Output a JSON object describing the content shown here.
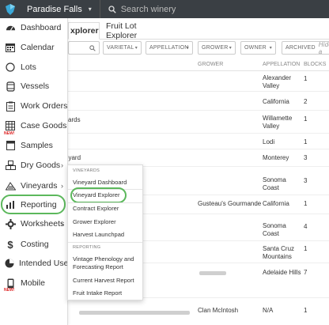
{
  "header": {
    "winery": "Paradise Falls",
    "search_placeholder": "Search winery"
  },
  "sidebar": {
    "items": [
      {
        "label": "Dashboard",
        "icon": "dashboard-icon"
      },
      {
        "label": "Calendar",
        "icon": "calendar-icon"
      },
      {
        "label": "Lots",
        "icon": "lots-icon"
      },
      {
        "label": "Vessels",
        "icon": "vessels-icon"
      },
      {
        "label": "Work Orders",
        "icon": "work-orders-icon"
      },
      {
        "label": "Case Goods",
        "icon": "case-goods-icon",
        "badge": "NEW!"
      },
      {
        "label": "Samples",
        "icon": "samples-icon"
      },
      {
        "label": "Dry Goods",
        "icon": "dry-goods-icon"
      },
      {
        "label": "Vineyards",
        "icon": "vineyards-icon"
      },
      {
        "label": "Reporting",
        "icon": "reporting-icon"
      },
      {
        "label": "Worksheets",
        "icon": "worksheets-icon"
      },
      {
        "label": "Costing",
        "icon": "costing-icon"
      },
      {
        "label": "Intended Use",
        "icon": "intended-use-icon"
      },
      {
        "label": "Mobile",
        "icon": "mobile-icon",
        "badge": "NEW!"
      }
    ]
  },
  "tabs": {
    "active": "xplorer",
    "other": "Fruit Lot Explorer"
  },
  "filters": {
    "varietal": "VARIETAL",
    "appellation": "APPELLATION",
    "grower": "GROWER",
    "owner": "OWNER",
    "archived": "ARCHIVED",
    "hide": "Hide a"
  },
  "table": {
    "headers": {
      "grower": "GROWER",
      "appellation": "APPELLATION",
      "blocks": "BLOCKS"
    },
    "rows": [
      {
        "name": "",
        "grower": "",
        "appellation": "Alexander Valley",
        "blocks": "1"
      },
      {
        "name": "o",
        "grower": "",
        "appellation": "California",
        "blocks": "2"
      },
      {
        "name": "ards",
        "grower": "",
        "appellation": "Willamette Valley",
        "blocks": "1"
      },
      {
        "name": "",
        "grower": "",
        "appellation": "Lodi",
        "blocks": "1"
      },
      {
        "name": "eyard",
        "grower": "",
        "appellation": "Monterey",
        "blocks": "3"
      },
      {
        "name": "",
        "grower": "",
        "appellation": "Sonoma Coast",
        "blocks": "3"
      },
      {
        "name": "",
        "grower": "Gusteau's Gourmande",
        "appellation": "California",
        "blocks": "1"
      },
      {
        "name": "",
        "grower": "",
        "appellation": "Sonoma Coast",
        "blocks": "4"
      },
      {
        "name": "",
        "grower": "",
        "appellation": "Santa Cruz Mountains",
        "blocks": "1"
      },
      {
        "name": "",
        "grower": "",
        "appellation": "Adelaide Hills",
        "blocks": "7"
      },
      {
        "name": "",
        "grower": "Clan McIntosh",
        "appellation": "N/A",
        "blocks": "1"
      }
    ]
  },
  "dropdown": {
    "vineyards_section": "VINEYARDS",
    "vineyards_items": [
      "Vineyard Dashboard",
      "Vineyard Explorer",
      "Contract Explorer",
      "Grower Explorer",
      "Harvest Launchpad"
    ],
    "reporting_section": "REPORTING",
    "reporting_items": [
      "Vintage Phenology and",
      "Forecasting Report",
      "Current Harvest Report",
      "Fruit Intake Report"
    ]
  },
  "colors": {
    "topbar": "#3a3f44",
    "highlight": "#5cb85c",
    "new_badge": "#d22222"
  }
}
